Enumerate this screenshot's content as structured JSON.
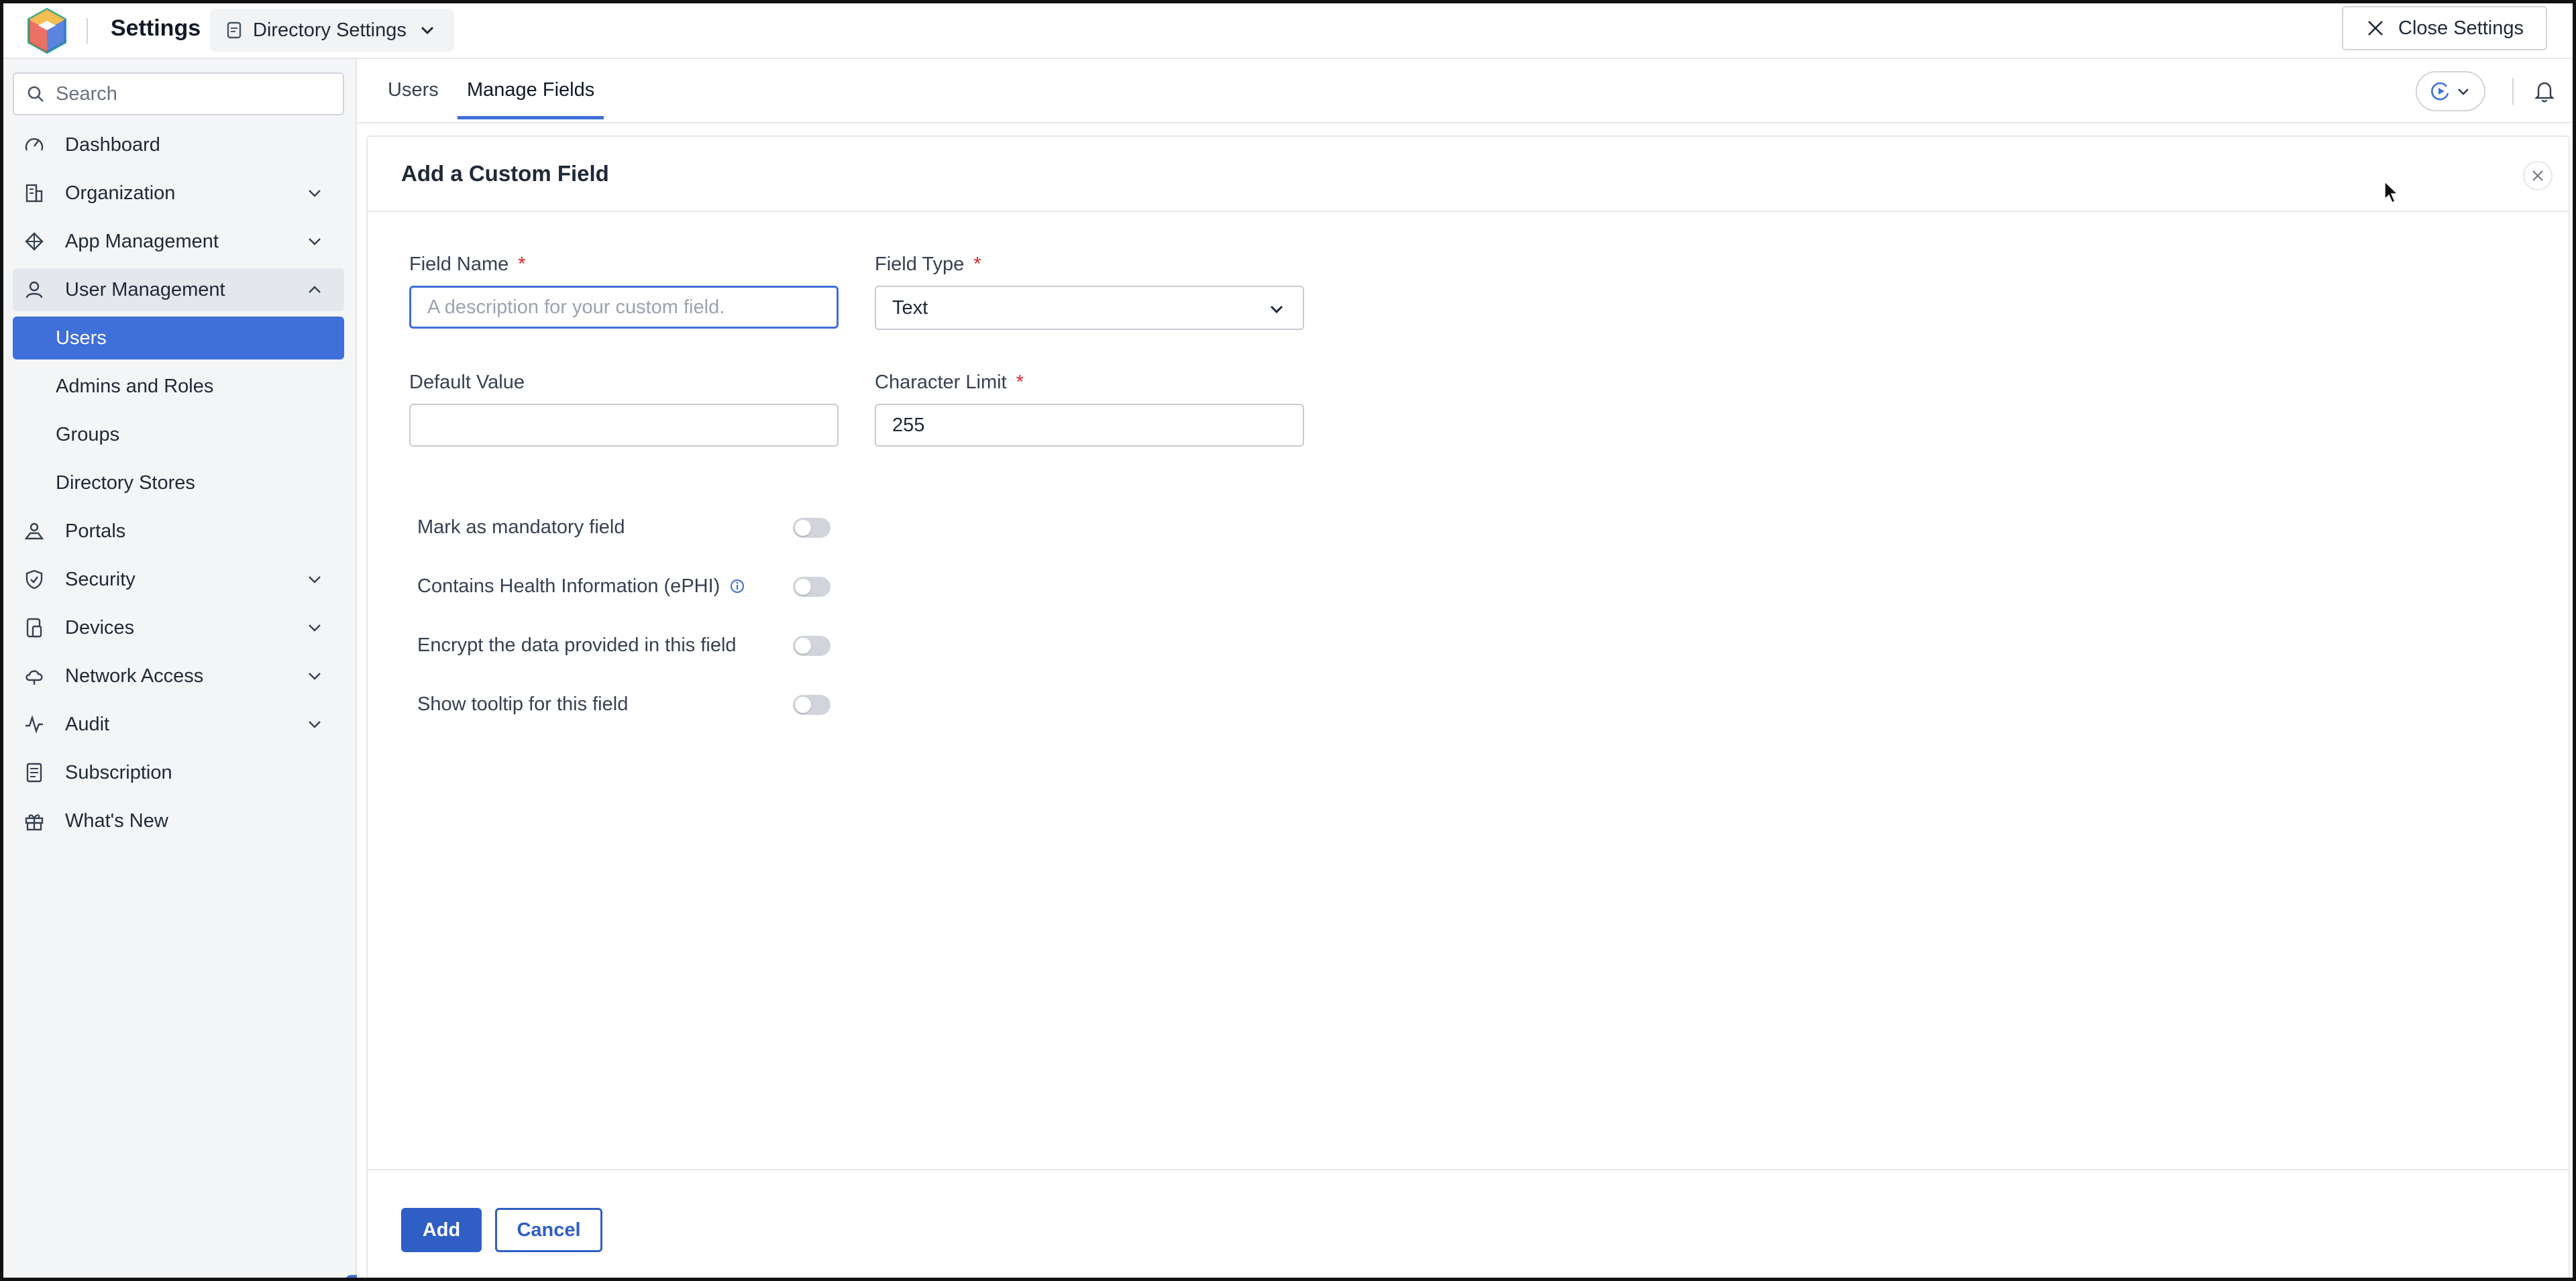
{
  "app": {
    "title": "Settings",
    "directory_switch": "Directory Settings",
    "close_label": "Close Settings"
  },
  "sidebar": {
    "search_placeholder": "Search",
    "items": [
      {
        "label": "Dashboard",
        "icon": "dashboard-gauge-icon"
      },
      {
        "label": "Organization",
        "icon": "organization-building-icon",
        "expandable": true
      },
      {
        "label": "App Management",
        "icon": "app-management-icon",
        "expandable": true
      },
      {
        "label": "User Management",
        "icon": "user-icon",
        "expandable": true,
        "expanded": true
      },
      {
        "label": "Users",
        "sub": true,
        "active": true
      },
      {
        "label": "Admins and Roles",
        "sub": true
      },
      {
        "label": "Groups",
        "sub": true
      },
      {
        "label": "Directory Stores",
        "sub": true
      },
      {
        "label": "Portals",
        "icon": "portal-icon"
      },
      {
        "label": "Security",
        "icon": "shield-icon",
        "expandable": true
      },
      {
        "label": "Devices",
        "icon": "devices-icon",
        "expandable": true
      },
      {
        "label": "Network Access",
        "icon": "cloud-icon",
        "expandable": true
      },
      {
        "label": "Audit",
        "icon": "activity-icon",
        "expandable": true
      },
      {
        "label": "Subscription",
        "icon": "subscription-icon"
      },
      {
        "label": "What's New",
        "icon": "gift-icon"
      }
    ]
  },
  "tabs": [
    {
      "label": "Users",
      "active": false
    },
    {
      "label": "Manage Fields",
      "active": true
    }
  ],
  "panel": {
    "title": "Add a Custom Field",
    "field_name": {
      "label": "Field Name",
      "required_mark": "*",
      "placeholder": "A description for your custom field.",
      "value": ""
    },
    "field_type": {
      "label": "Field Type",
      "required_mark": "*",
      "value": "Text"
    },
    "default_value": {
      "label": "Default Value",
      "value": ""
    },
    "character_limit": {
      "label": "Character Limit",
      "required_mark": "*",
      "value": "255"
    },
    "toggles": [
      {
        "label": "Mark as mandatory field",
        "on": false
      },
      {
        "label": "Contains Health Information (ePHI)",
        "on": false,
        "info": true
      },
      {
        "label": "Encrypt the data provided in this field",
        "on": false
      },
      {
        "label": "Show tooltip for this field",
        "on": false
      }
    ],
    "add_label": "Add",
    "cancel_label": "Cancel"
  },
  "colors": {
    "accent": "#3f6fd8",
    "primary_button": "#2f5fc4",
    "required": "#dc2626"
  }
}
